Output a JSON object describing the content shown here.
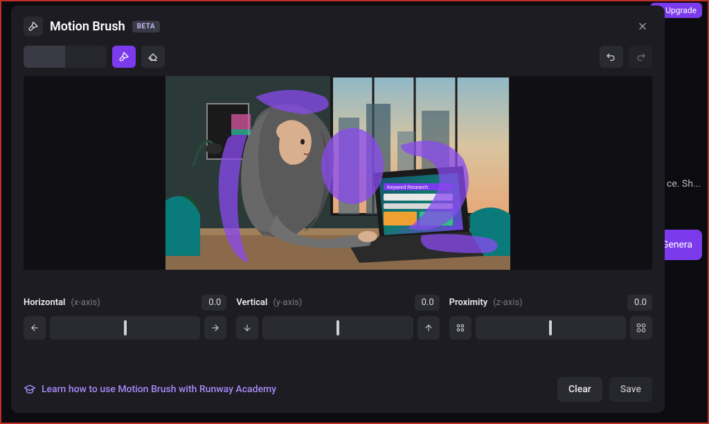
{
  "background": {
    "upgrade_label": "Upgrade",
    "truncated_text": "ce. Sh...",
    "generate_label": "Genera"
  },
  "header": {
    "title": "Motion Brush",
    "badge": "BETA"
  },
  "toolbar": {
    "icons": {
      "brush": "brush-icon",
      "eraser": "eraser-icon",
      "undo": "undo-icon",
      "redo": "redo-icon"
    }
  },
  "canvas": {
    "description": "Woman in hijab at laptop in office with purple brush strokes overlay",
    "laptop_title": "Keyword Research"
  },
  "controls": {
    "horizontal": {
      "label": "Horizontal",
      "axis": "(x-axis)",
      "value": "0.0"
    },
    "vertical": {
      "label": "Vertical",
      "axis": "(y-axis)",
      "value": "0.0"
    },
    "proximity": {
      "label": "Proximity",
      "axis": "(z-axis)",
      "value": "0.0"
    }
  },
  "footer": {
    "learn_label": "Learn how to use Motion Brush with Runway Academy",
    "clear_label": "Clear",
    "save_label": "Save"
  },
  "colors": {
    "accent": "#7c3aed",
    "surface": "#1c1c22",
    "surface2": "#2a2a32"
  }
}
